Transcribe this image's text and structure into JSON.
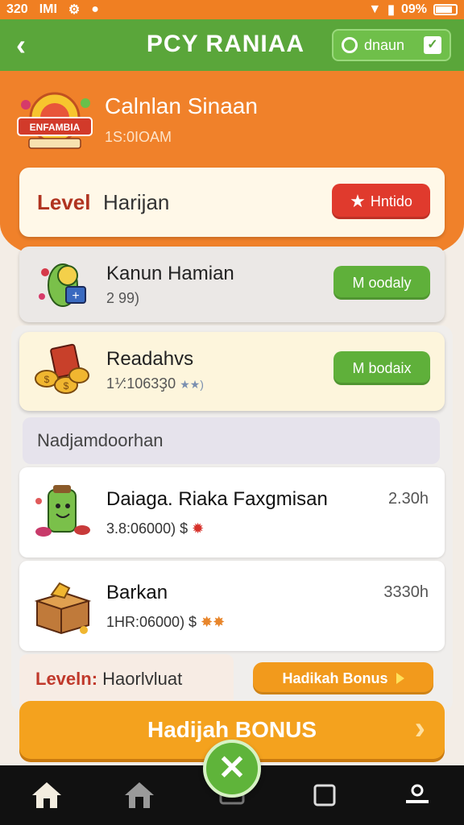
{
  "status_bar": {
    "time": "320",
    "label": "IMI",
    "battery": "09%"
  },
  "header": {
    "title": "PCY RANIAA",
    "pill_label": "dnaun"
  },
  "hero": {
    "title": "Calnlan Sinaan",
    "time": "1S:0IOAM",
    "logo_text": "ENFAMBIA"
  },
  "level_card": {
    "label_a": "Level",
    "label_b": "Harijan",
    "button": "Hntido"
  },
  "kanan_card": {
    "title": "Kanun Hamian",
    "sub": "2 99)",
    "button": "M oodaly"
  },
  "read_card": {
    "title": "Readahvs",
    "sub": "1⅟:1063Ҙ0",
    "button": "M bodaix"
  },
  "section_label": "Nadjamdoorhan",
  "list": [
    {
      "title": "Daiaga. Riaka Faxgmisan",
      "sub": "3.8:06000) $",
      "time": "2.30h"
    },
    {
      "title": "Barkan",
      "sub": "1HR:06000) $",
      "time": "3330h"
    }
  ],
  "bottom_strip": {
    "label_a": "Leveln:",
    "label_b": "Haorlvluat",
    "button": "Hadikah Bonus"
  },
  "bonus_button": "Hadijah BONUS",
  "colors": {
    "orange": "#f0812a",
    "green": "#5aa63a",
    "red": "#e03a2d",
    "gold": "#f4a21e"
  }
}
